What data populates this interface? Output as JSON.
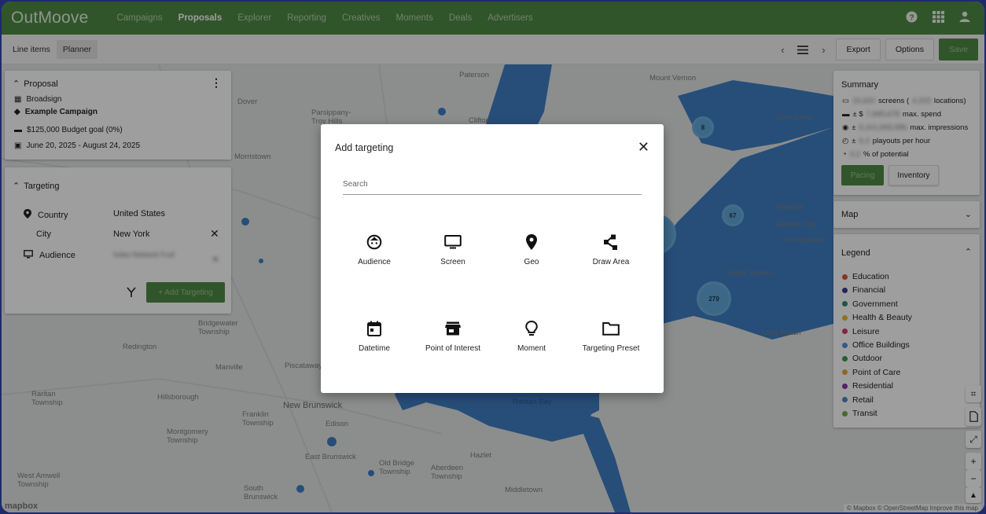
{
  "nav": {
    "logo": "OutMoove",
    "links": [
      "Campaigns",
      "Proposals",
      "Explorer",
      "Reporting",
      "Creatives",
      "Moments",
      "Deals",
      "Advertisers"
    ],
    "active": "Proposals"
  },
  "toolbar": {
    "tabs": [
      "Line items",
      "Planner"
    ],
    "active_tab": "Planner",
    "export_label": "Export",
    "options_label": "Options",
    "save_label": "Save"
  },
  "proposal": {
    "header": "Proposal",
    "network": "Broadsign",
    "campaign": "Example Campaign",
    "budget": "$125,000 Budget goal (0%)",
    "dates": "June 20, 2025 - August 24, 2025"
  },
  "targeting": {
    "header": "Targeting",
    "rows": [
      {
        "label": "Country",
        "value": "United States"
      },
      {
        "label": "City",
        "value": "New York"
      },
      {
        "label": "Audience",
        "value": "Index Network Fruit"
      }
    ],
    "add_label": "+ Add Targeting"
  },
  "summary": {
    "title": "Summary",
    "screens_count": "15,620",
    "screens_text": "screens (",
    "locations_count": "4,319",
    "locations_text": "locations)",
    "spend_prefix": "± $",
    "spend_value": "7,845,678",
    "spend_text": "max. spend",
    "impr_prefix": "±",
    "impr_value": "6,101,693,986",
    "impr_text": "max. impressions",
    "playouts_prefix": "±",
    "playouts_value": "6.2",
    "playouts_text": "playouts per hour",
    "potential_value": "3.2",
    "potential_text": "% of potential",
    "pacing_label": "Pacing",
    "inventory_label": "Inventory"
  },
  "map_select": {
    "label": "Map"
  },
  "legend": {
    "title": "Legend",
    "items": [
      {
        "label": "Education",
        "color": "#e0503c"
      },
      {
        "label": "Financial",
        "color": "#3b3a9c"
      },
      {
        "label": "Government",
        "color": "#2f8a74"
      },
      {
        "label": "Health & Beauty",
        "color": "#e8b92f"
      },
      {
        "label": "Leisure",
        "color": "#d23b6b"
      },
      {
        "label": "Office Buildings",
        "color": "#5b8fe0"
      },
      {
        "label": "Outdoor",
        "color": "#3d9a4a"
      },
      {
        "label": "Point of Care",
        "color": "#e0a83a"
      },
      {
        "label": "Residential",
        "color": "#8e35a8"
      },
      {
        "label": "Retail",
        "color": "#4f86c6"
      },
      {
        "label": "Transit",
        "color": "#7aa847"
      }
    ]
  },
  "map": {
    "places": [
      "Paterson",
      "Mount Vernon",
      "Dover",
      "Parsippany-Troy Hills",
      "Clifton",
      "Glen Cove",
      "Mineola",
      "Garden City",
      "Hempstead",
      "Valley Stream",
      "Long Beach",
      "Bridgewater Township",
      "Redington",
      "Manville",
      "Piscataway",
      "Raritan Township",
      "Hillsborough",
      "New Brunswick",
      "Franklin Township",
      "Montgomery Township",
      "East Brunswick",
      "Old Bridge Township",
      "Hazlet",
      "Aberdeen Township",
      "Middletown",
      "West Amwell Township",
      "South Brunswick",
      "Morristown",
      "Edison",
      "Raritan Bay"
    ],
    "clusters": [
      "8",
      "67",
      "279"
    ],
    "mapbox": "mapbox",
    "attribution": "© Mapbox © OpenStreetMap Improve this map"
  },
  "modal": {
    "title": "Add targeting",
    "search_placeholder": "Search",
    "options": [
      {
        "label": "Audience",
        "icon": "audience-icon"
      },
      {
        "label": "Screen",
        "icon": "screen-icon"
      },
      {
        "label": "Geo",
        "icon": "geo-pin-icon"
      },
      {
        "label": "Draw Area",
        "icon": "draw-area-icon"
      },
      {
        "label": "Datetime",
        "icon": "calendar-icon"
      },
      {
        "label": "Point of Interest",
        "icon": "store-icon"
      },
      {
        "label": "Moment",
        "icon": "lightbulb-icon"
      },
      {
        "label": "Targeting Preset",
        "icon": "folder-icon"
      }
    ]
  },
  "colors": {
    "brand_green": "#4f8a45",
    "water": "#3f7fc4",
    "cluster": "#62a7d9"
  }
}
